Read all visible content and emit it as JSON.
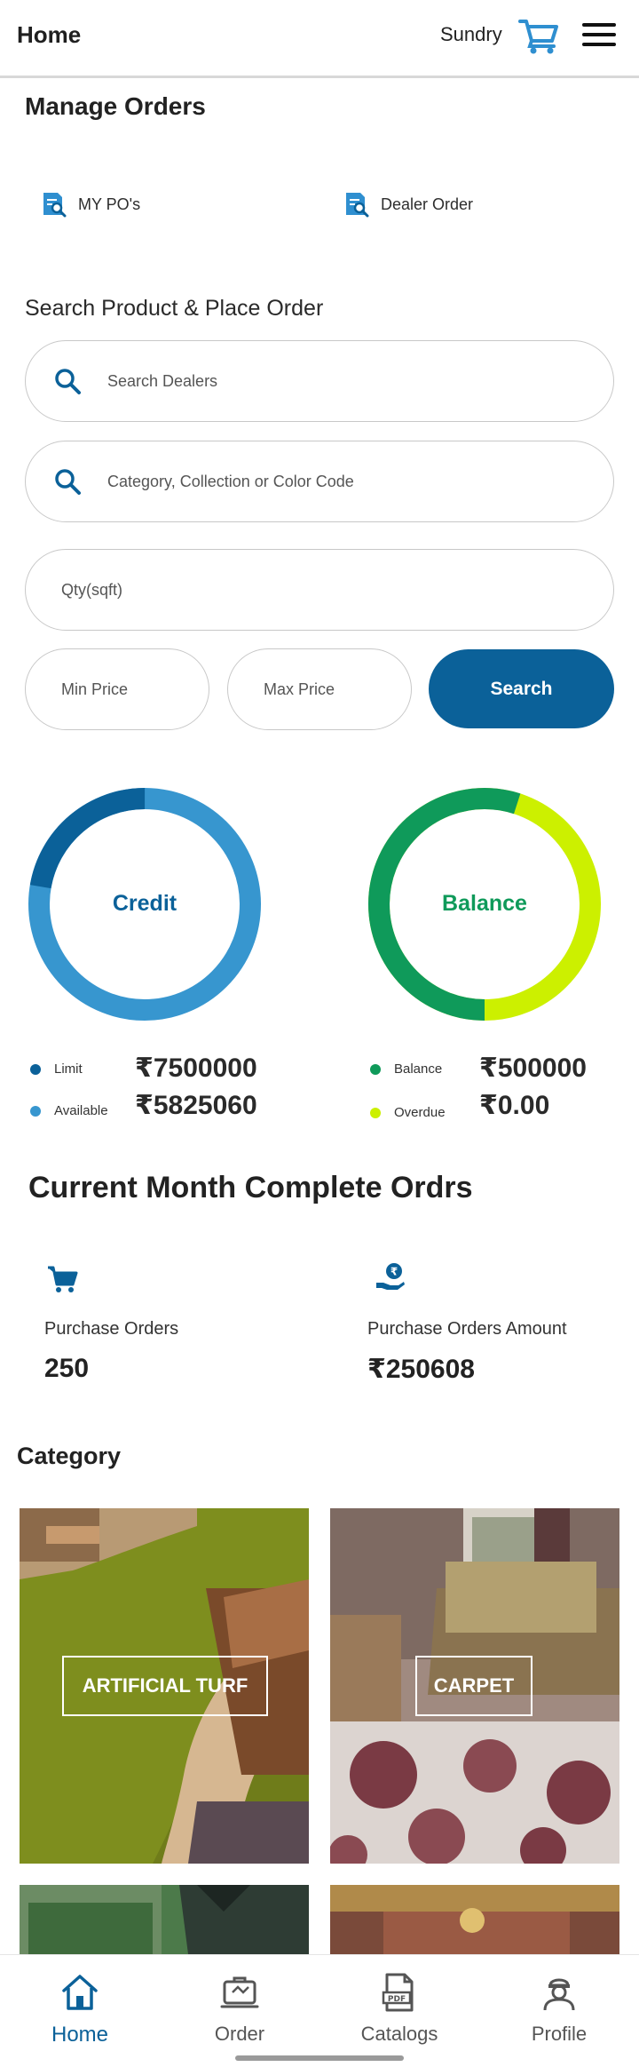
{
  "appbar": {
    "title": "Home",
    "user": "Sundry",
    "cart_icon": "cart-icon",
    "menu_icon": "hamburger-menu-icon"
  },
  "manage": {
    "title": "Manage Orders",
    "links": [
      {
        "label": "MY PO's",
        "icon": "document-search-icon"
      },
      {
        "label": "Dealer Order",
        "icon": "document-search-icon"
      }
    ]
  },
  "search": {
    "heading": "Search Product & Place Order",
    "dealers_placeholder": "Search Dealers",
    "category_placeholder": "Category, Collection or Color Code",
    "qty_placeholder": "Qty(sqft)",
    "min_price_placeholder": "Min Price",
    "max_price_placeholder": "Max Price",
    "button_label": "Search"
  },
  "colors": {
    "primary": "#0b6199",
    "credit_available": "#3796cf",
    "balance": "#0f9a5a",
    "overdue": "#ccf000"
  },
  "credit": {
    "label": "Credit",
    "limit_label": "Limit",
    "limit_value": "₹7500000",
    "available_label": "Available",
    "available_value": "₹5825060",
    "limit_amount": 7500000,
    "available_amount": 5825060
  },
  "balance": {
    "label": "Balance",
    "balance_label": "Balance",
    "balance_value": "₹500000",
    "overdue_label": "Overdue",
    "overdue_value": "₹0.00"
  },
  "month": {
    "title": "Current Month Complete Ordrs",
    "stats": [
      {
        "label": "Purchase Orders",
        "value": "250",
        "icon": "cart-icon"
      },
      {
        "label": "Purchase Orders Amount",
        "value": "₹250608",
        "icon": "rupee-hand-icon"
      }
    ]
  },
  "category": {
    "title": "Category",
    "tiles": [
      {
        "label": "ARTIFICIAL TURF"
      },
      {
        "label": "CARPET"
      },
      {
        "label": ""
      },
      {
        "label": ""
      }
    ]
  },
  "bottom_nav": [
    {
      "label": "Home",
      "icon": "home-icon",
      "active": true
    },
    {
      "label": "Order",
      "icon": "order-icon",
      "active": false
    },
    {
      "label": "Catalogs",
      "icon": "pdf-catalog-icon",
      "active": false
    },
    {
      "label": "Profile",
      "icon": "profile-icon",
      "active": false
    }
  ]
}
